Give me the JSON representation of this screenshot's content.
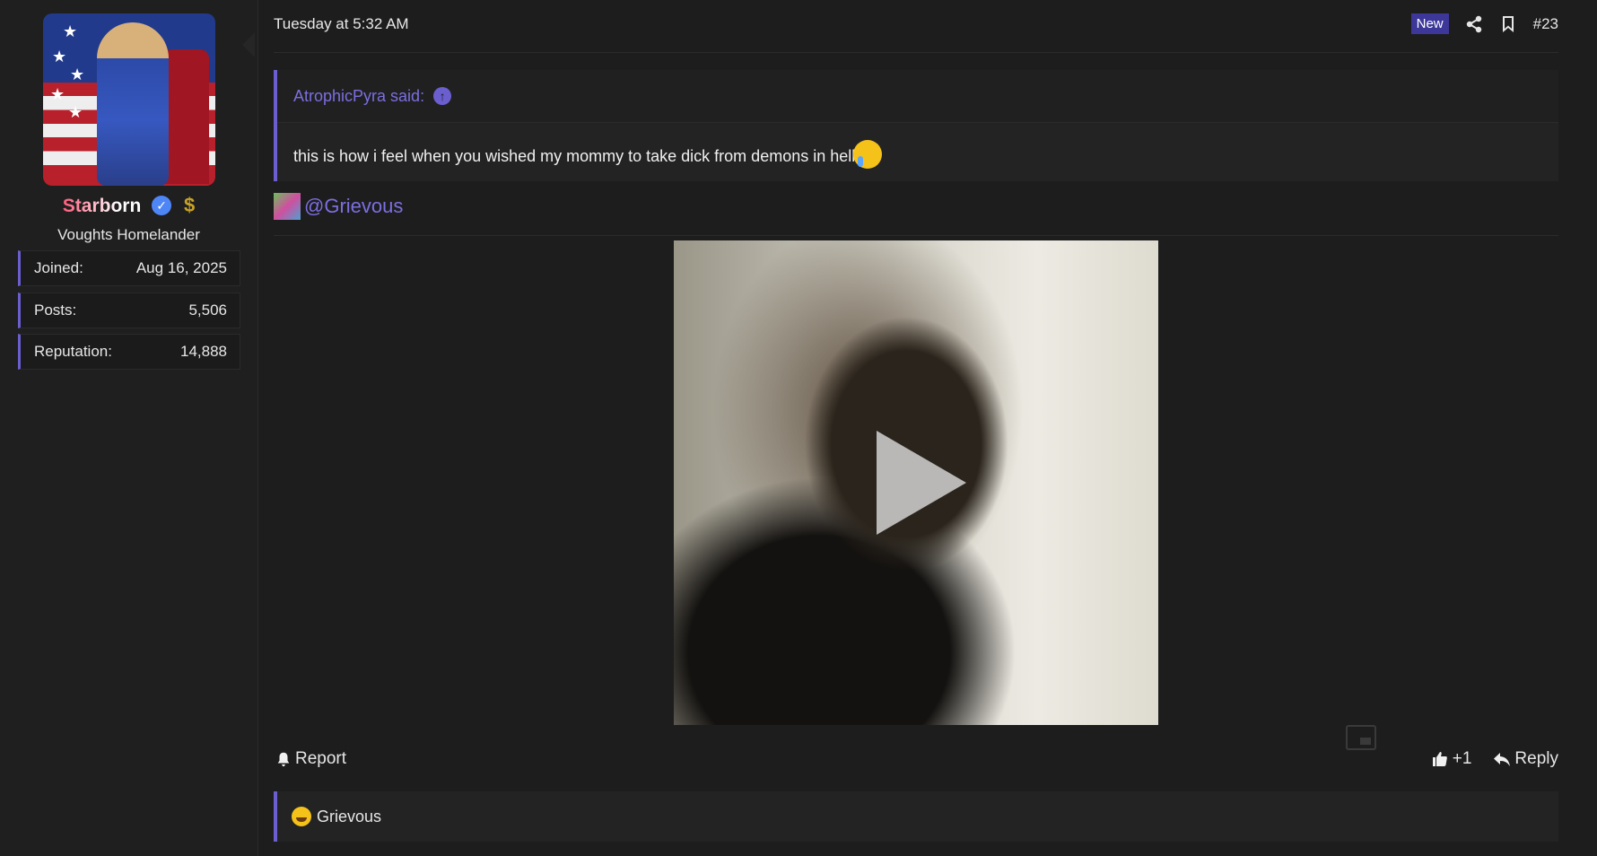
{
  "user": {
    "username": "Starborn",
    "title": "Voughts Homelander",
    "verified_icon": "verified-badge-icon",
    "currency_icon": "dollar-icon",
    "stats": [
      {
        "label": "Joined:",
        "value": "Aug 16, 2025"
      },
      {
        "label": "Posts:",
        "value": "5,506"
      },
      {
        "label": "Reputation:",
        "value": "14,888"
      }
    ]
  },
  "post": {
    "date": "Tuesday at 5:32 AM",
    "new_badge": "New",
    "number": "#23",
    "quote": {
      "author": "AtrophicPyra said:",
      "text": "this is how i feel when you wished my mommy to take dick from demons in hell"
    },
    "mention": "@Grievous",
    "video": {
      "state": "paused"
    },
    "actions": {
      "report": "Report",
      "like": "+1",
      "reply": "Reply"
    },
    "reactions": {
      "user": "Grievous"
    }
  },
  "colors": {
    "accent": "#6b5fd0",
    "background": "#1d1d1d",
    "new_badge": "#3c3799"
  }
}
